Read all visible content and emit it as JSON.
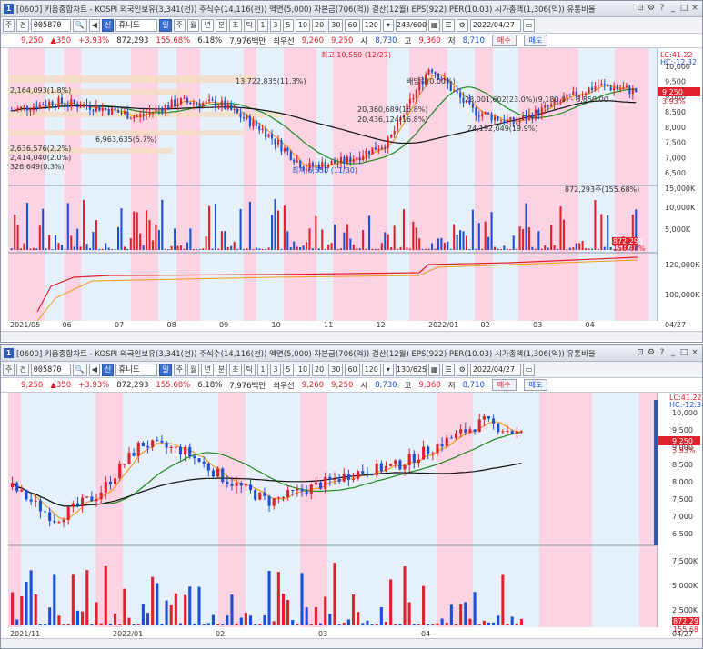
{
  "app": {
    "window_title": "[0600] 키움종합차트 - KOSPI 외국인보유(3,341(천)) 주식수(14,116(천)) 액면(5,000) 자본금(706(억)) 결산(12월) EPS(922) PER(10.03) 시가총액(1,306(억)) 유통비율",
    "window_icon": "1"
  },
  "toolbar": {
    "mode_labels": [
      "주",
      "견"
    ],
    "code": "005870",
    "name_prefix": "신",
    "name": "휴니드",
    "period_buttons": [
      "일",
      "주",
      "월",
      "년",
      "분",
      "초",
      "틱"
    ],
    "interval_buttons": [
      "1",
      "3",
      "5",
      "10",
      "20",
      "30",
      "60",
      "120"
    ],
    "date": "2022/04/27"
  },
  "panels": [
    {
      "count": "243/600"
    },
    {
      "count": "130/625"
    }
  ],
  "price": {
    "current": "9,250",
    "change": "350",
    "change_pct": "+3.93%",
    "volume": "872,293",
    "volume_pct": "155.68%",
    "turnover": "6.18%",
    "amount": "7,976백만",
    "best_label": "최우선",
    "ask": "9,260",
    "bid": "9,250",
    "open_label": "시",
    "open": "8,730",
    "high_label": "고",
    "high": "9,360",
    "low_label": "저",
    "low": "8,710",
    "buy_label": "매수",
    "sell_label": "매도"
  },
  "chart1": {
    "annotations": {
      "high": "최고 10,550 (12/27)",
      "low": "최저 6,550 (11/30)",
      "dividend": "배당락(0.00%)",
      "vp1": "13,722,835(11.3%)",
      "vp2": "2,164,093(1.8%)",
      "vp3": "20,360,689(16.8%)",
      "vp4": "20,436,124(16.8%)",
      "vp5": "28,001,602(23.0%)(9,180.0) - 8,850.00",
      "vp6": "24,192,049(19.9%)",
      "vp7": "6,963,635(5.7%)",
      "vp8": "2,636,576(2.2%)",
      "vp9": "2,414,040(2.0%)",
      "vp10": "326,649(0.3%)",
      "volume_tag": "872,293주(155.68%)"
    },
    "y_axis": [
      "10,000",
      "9,500",
      "9,000",
      "8,500",
      "8,000",
      "7,500",
      "7,000",
      "6,500"
    ],
    "lc_hc": [
      "LC:41.22",
      "HC:-12.32"
    ],
    "current_tag": "9,250",
    "current_pct": "3.93%",
    "vol_axis": [
      "15,000K",
      "10,000K",
      "5,000K"
    ],
    "vol_tag": "872,293",
    "vol_pct": "155.68%",
    "sub_axis": [
      "120,000K",
      "100,000K"
    ],
    "x_labels": [
      "2021/05",
      "06",
      "07",
      "08",
      "09",
      "10",
      "11",
      "12",
      "2022/01",
      "02",
      "03",
      "04"
    ],
    "end_date": "04/27"
  },
  "chart2": {
    "y_axis": [
      "10,000",
      "9,500",
      "9,000",
      "8,500",
      "8,000",
      "7,500",
      "7,000",
      "6,500"
    ],
    "lc_hc": [
      "LC:41.22",
      "HC:-12.3"
    ],
    "current_tag": "9,250",
    "current_pct": "3.93%",
    "vol_axis": [
      "7,500K",
      "5,000K",
      "2,500K"
    ],
    "vol_tag": "872,29",
    "vol_pct": "155.68",
    "x_labels": [
      "2021/11",
      "2022/01",
      "02",
      "03",
      "04"
    ],
    "end_date": "04/27"
  },
  "colors": {
    "up": "#e0202a",
    "down": "#1a4fd6",
    "pink_band": "#fbd3e3",
    "blue_band": "#e6f0fa",
    "ma_orange": "#f29a1d",
    "ma_green": "#1f8a1f",
    "ma_black": "#111111"
  }
}
